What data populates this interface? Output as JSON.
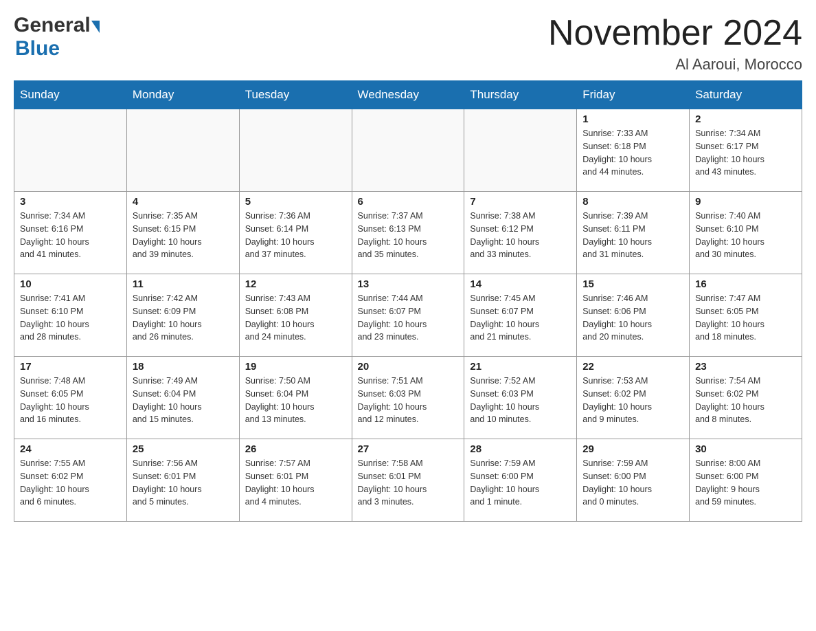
{
  "header": {
    "logo_general": "General",
    "logo_blue": "Blue",
    "month_title": "November 2024",
    "location": "Al Aaroui, Morocco"
  },
  "days_of_week": [
    "Sunday",
    "Monday",
    "Tuesday",
    "Wednesday",
    "Thursday",
    "Friday",
    "Saturday"
  ],
  "weeks": [
    {
      "days": [
        {
          "number": "",
          "info": ""
        },
        {
          "number": "",
          "info": ""
        },
        {
          "number": "",
          "info": ""
        },
        {
          "number": "",
          "info": ""
        },
        {
          "number": "",
          "info": ""
        },
        {
          "number": "1",
          "info": "Sunrise: 7:33 AM\nSunset: 6:18 PM\nDaylight: 10 hours\nand 44 minutes."
        },
        {
          "number": "2",
          "info": "Sunrise: 7:34 AM\nSunset: 6:17 PM\nDaylight: 10 hours\nand 43 minutes."
        }
      ]
    },
    {
      "days": [
        {
          "number": "3",
          "info": "Sunrise: 7:34 AM\nSunset: 6:16 PM\nDaylight: 10 hours\nand 41 minutes."
        },
        {
          "number": "4",
          "info": "Sunrise: 7:35 AM\nSunset: 6:15 PM\nDaylight: 10 hours\nand 39 minutes."
        },
        {
          "number": "5",
          "info": "Sunrise: 7:36 AM\nSunset: 6:14 PM\nDaylight: 10 hours\nand 37 minutes."
        },
        {
          "number": "6",
          "info": "Sunrise: 7:37 AM\nSunset: 6:13 PM\nDaylight: 10 hours\nand 35 minutes."
        },
        {
          "number": "7",
          "info": "Sunrise: 7:38 AM\nSunset: 6:12 PM\nDaylight: 10 hours\nand 33 minutes."
        },
        {
          "number": "8",
          "info": "Sunrise: 7:39 AM\nSunset: 6:11 PM\nDaylight: 10 hours\nand 31 minutes."
        },
        {
          "number": "9",
          "info": "Sunrise: 7:40 AM\nSunset: 6:10 PM\nDaylight: 10 hours\nand 30 minutes."
        }
      ]
    },
    {
      "days": [
        {
          "number": "10",
          "info": "Sunrise: 7:41 AM\nSunset: 6:10 PM\nDaylight: 10 hours\nand 28 minutes."
        },
        {
          "number": "11",
          "info": "Sunrise: 7:42 AM\nSunset: 6:09 PM\nDaylight: 10 hours\nand 26 minutes."
        },
        {
          "number": "12",
          "info": "Sunrise: 7:43 AM\nSunset: 6:08 PM\nDaylight: 10 hours\nand 24 minutes."
        },
        {
          "number": "13",
          "info": "Sunrise: 7:44 AM\nSunset: 6:07 PM\nDaylight: 10 hours\nand 23 minutes."
        },
        {
          "number": "14",
          "info": "Sunrise: 7:45 AM\nSunset: 6:07 PM\nDaylight: 10 hours\nand 21 minutes."
        },
        {
          "number": "15",
          "info": "Sunrise: 7:46 AM\nSunset: 6:06 PM\nDaylight: 10 hours\nand 20 minutes."
        },
        {
          "number": "16",
          "info": "Sunrise: 7:47 AM\nSunset: 6:05 PM\nDaylight: 10 hours\nand 18 minutes."
        }
      ]
    },
    {
      "days": [
        {
          "number": "17",
          "info": "Sunrise: 7:48 AM\nSunset: 6:05 PM\nDaylight: 10 hours\nand 16 minutes."
        },
        {
          "number": "18",
          "info": "Sunrise: 7:49 AM\nSunset: 6:04 PM\nDaylight: 10 hours\nand 15 minutes."
        },
        {
          "number": "19",
          "info": "Sunrise: 7:50 AM\nSunset: 6:04 PM\nDaylight: 10 hours\nand 13 minutes."
        },
        {
          "number": "20",
          "info": "Sunrise: 7:51 AM\nSunset: 6:03 PM\nDaylight: 10 hours\nand 12 minutes."
        },
        {
          "number": "21",
          "info": "Sunrise: 7:52 AM\nSunset: 6:03 PM\nDaylight: 10 hours\nand 10 minutes."
        },
        {
          "number": "22",
          "info": "Sunrise: 7:53 AM\nSunset: 6:02 PM\nDaylight: 10 hours\nand 9 minutes."
        },
        {
          "number": "23",
          "info": "Sunrise: 7:54 AM\nSunset: 6:02 PM\nDaylight: 10 hours\nand 8 minutes."
        }
      ]
    },
    {
      "days": [
        {
          "number": "24",
          "info": "Sunrise: 7:55 AM\nSunset: 6:02 PM\nDaylight: 10 hours\nand 6 minutes."
        },
        {
          "number": "25",
          "info": "Sunrise: 7:56 AM\nSunset: 6:01 PM\nDaylight: 10 hours\nand 5 minutes."
        },
        {
          "number": "26",
          "info": "Sunrise: 7:57 AM\nSunset: 6:01 PM\nDaylight: 10 hours\nand 4 minutes."
        },
        {
          "number": "27",
          "info": "Sunrise: 7:58 AM\nSunset: 6:01 PM\nDaylight: 10 hours\nand 3 minutes."
        },
        {
          "number": "28",
          "info": "Sunrise: 7:59 AM\nSunset: 6:00 PM\nDaylight: 10 hours\nand 1 minute."
        },
        {
          "number": "29",
          "info": "Sunrise: 7:59 AM\nSunset: 6:00 PM\nDaylight: 10 hours\nand 0 minutes."
        },
        {
          "number": "30",
          "info": "Sunrise: 8:00 AM\nSunset: 6:00 PM\nDaylight: 9 hours\nand 59 minutes."
        }
      ]
    }
  ]
}
